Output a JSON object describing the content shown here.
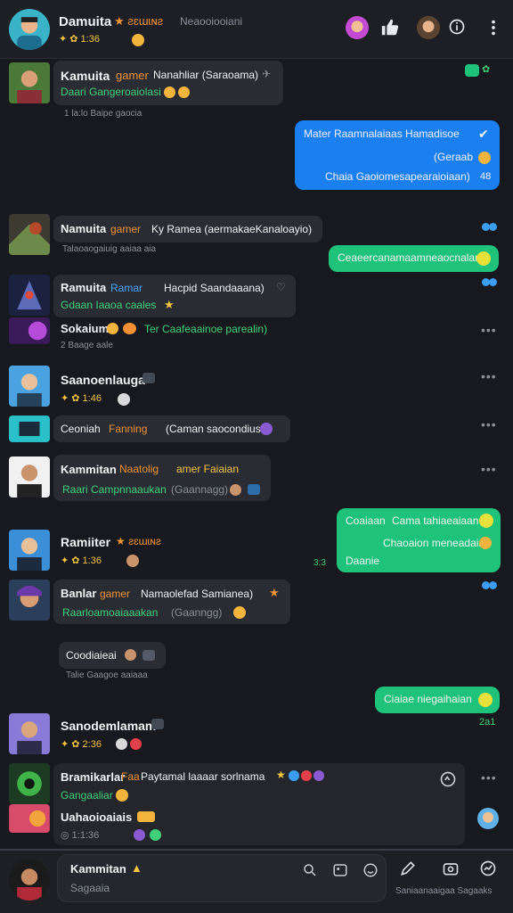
{
  "colors": {
    "accent_blue": "#1a7ff0",
    "accent_green": "#1ec27a",
    "bg": "#17191e",
    "bubble": "#2a2c33"
  },
  "header": {
    "title": "Damuita",
    "title_tag": "★ ƨɛɯɩɴƨ",
    "subtitle": "Neaooiooiani",
    "status": "✦ ✿ 1:36",
    "icons": [
      "avatar-1",
      "thumbs-up-icon",
      "avatar-2",
      "info-icon",
      "more-vertical-icon"
    ]
  },
  "messages": {
    "m1": {
      "name": "Kamuita",
      "tag": "gamer",
      "text": "Nanahliar (Saraoama)",
      "sub": "Daari Gangeroaiolasi",
      "time": "1 la:lo Baipe gaocia"
    },
    "m2": {
      "line1": "Mater Raamnalaiaas Hamadisoe",
      "line2": "(Geraab",
      "line3": "Chaia Gaoiomesapearaioiaan)",
      "time": "48"
    },
    "m3": {
      "name": "Namuita",
      "tag": "gamer",
      "text": "Ky Ramea (aermakaeKanaloayio)",
      "time": "Talaoaogaiuig aaiaa aia"
    },
    "m4": {
      "text": "Ceaeercanamaamneaocnalan"
    },
    "m5": {
      "name": "Ramuita",
      "tag": "Ramar",
      "text": "Hacpid Saandaaana)",
      "sub": "Gdaan Iaaoa caales"
    },
    "m6": {
      "name": "Sokaium",
      "text": "Ter Caafeaainoe parealin)",
      "time": "2 Baage aale"
    },
    "m7": {
      "name": "Saanoenlauga",
      "status": "✦ ✿ 1:46"
    },
    "m8": {
      "text": "Ceoniah",
      "tag": "Fanning",
      "rest": "(Caman saocondius"
    },
    "m9": {
      "name": "Kammitan",
      "tag": "Naatolig",
      "tag2": "amer Faiaian",
      "sub": "Raari Campnnaaukan",
      "sub2": "(Gaannagg)"
    },
    "m10": {
      "line1a": "Coaiaan",
      "line1b": "Cama tahiaeaiaan",
      "line2": "Chaoaion meneadaian",
      "line3": "Daanie",
      "time": "3:3"
    },
    "m11": {
      "name": "Ramiiter",
      "tag": "★ ƨɛɯɩɴƨ",
      "status": "✦ ✿ 1:36"
    },
    "m12": {
      "name": "Banlar",
      "tag": "gamer",
      "text": "Namaolefad Samianea)",
      "sub": "Raarloamoaiaaakan",
      "sub2": "(Gaanngg)"
    },
    "m13": {
      "text": "Coodiaieai",
      "time": "Talie Gaagoe aaiaaa"
    },
    "m14": {
      "text": "Ciaiae niegaihaian"
    },
    "m15": {
      "name": "Sanodemlamam",
      "status": "✦ ✿ 2:36",
      "time": "2a1"
    },
    "m16": {
      "name": "Bramikarlar",
      "tag": "Faa",
      "text": "Paytamal laaaar sorlnama",
      "sub": "Gangaaliar",
      "name2": "Uahaoioaiais",
      "status": "◎ 1:1:36"
    }
  },
  "composer": {
    "name": "Kammitan",
    "placeholder": "Sagaaia",
    "hint": "Saniaanaaigaa Sagaaks"
  },
  "bottom_icons": [
    "search-icon",
    "image-icon",
    "emoji-icon",
    "pen-icon",
    "camera-icon",
    "chart-icon"
  ]
}
